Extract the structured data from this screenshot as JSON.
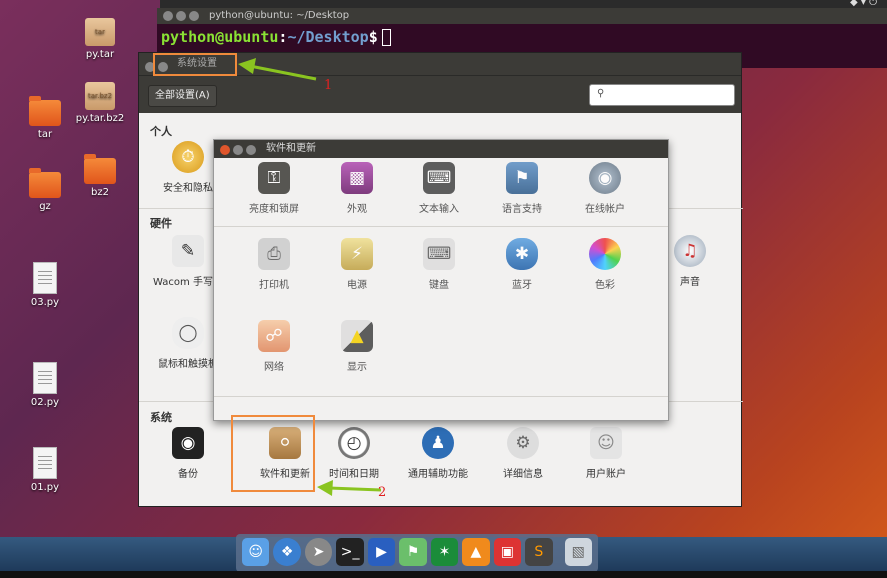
{
  "terminal": {
    "title": "python@ubuntu: ~/Desktop",
    "prompt_user": "python@ubuntu",
    "prompt_sep": ":",
    "prompt_path": "~/Desktop",
    "prompt_symbol": "$"
  },
  "desktop_icons": [
    {
      "label": "py.tar",
      "type": "archive",
      "badge": "tar"
    },
    {
      "label": "py.tar.bz2",
      "type": "archive",
      "badge": "tar.bz2"
    },
    {
      "label": "tar",
      "type": "folder"
    },
    {
      "label": "bz2",
      "type": "folder"
    },
    {
      "label": "gz",
      "type": "folder"
    },
    {
      "label": "03.py",
      "type": "file"
    },
    {
      "label": "02.py",
      "type": "file"
    },
    {
      "label": "01.py",
      "type": "file"
    }
  ],
  "settings": {
    "title": "系统设置",
    "all_settings": "全部设置(A)",
    "sections": {
      "personal": "个人",
      "hardware": "硬件",
      "system": "系统"
    },
    "personal_items": [
      "安全和隐私",
      "亮度和锁屏",
      "外观",
      "文本输入",
      "语言支持",
      "在线帐户"
    ],
    "hardware_items": [
      "Wacom 手写板",
      "打印机",
      "电源",
      "键盘",
      "蓝牙",
      "色彩",
      "声音",
      "鼠标和触摸板",
      "网络",
      "显示"
    ],
    "system_items": [
      "备份",
      "软件和更新",
      "时间和日期",
      "通用辅助功能",
      "详细信息",
      "用户账户"
    ]
  },
  "software_window": {
    "title": "软件和更新",
    "items": [
      "亮度和锁屏",
      "外观",
      "文本输入",
      "语言支持",
      "在线帐户",
      "打印机",
      "电源",
      "键盘",
      "蓝牙",
      "色彩",
      "网络",
      "显示"
    ]
  },
  "annotations": {
    "one": "1",
    "two": "2"
  },
  "dock": [
    "finder-icon",
    "safari-icon",
    "launchpad-icon",
    "terminal-icon",
    "media-icon",
    "maps-icon",
    "network-icon",
    "vlc-icon",
    "screen-icon",
    "sublime-icon",
    "trash-icon"
  ]
}
